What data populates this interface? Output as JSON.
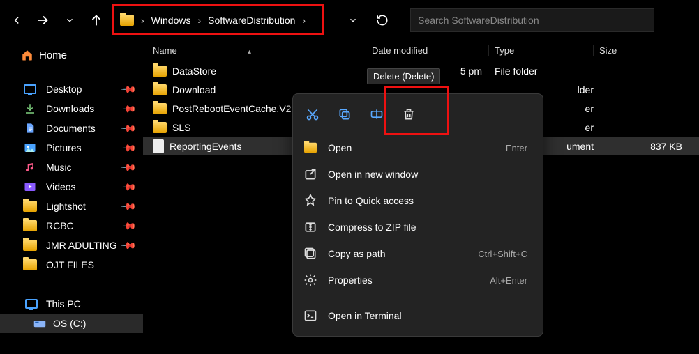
{
  "toolbar": {
    "breadcrumb": [
      "Windows",
      "SoftwareDistribution"
    ],
    "search_placeholder": "Search SoftwareDistribution"
  },
  "sidebar": {
    "home": "Home",
    "items": [
      {
        "label": "Desktop",
        "pin": true,
        "icon": "monitor"
      },
      {
        "label": "Downloads",
        "pin": true,
        "icon": "download"
      },
      {
        "label": "Documents",
        "pin": true,
        "icon": "document"
      },
      {
        "label": "Pictures",
        "pin": true,
        "icon": "pictures"
      },
      {
        "label": "Music",
        "pin": true,
        "icon": "music"
      },
      {
        "label": "Videos",
        "pin": true,
        "icon": "video"
      },
      {
        "label": "Lightshot",
        "pin": true,
        "icon": "folder"
      },
      {
        "label": "RCBC",
        "pin": true,
        "icon": "folder"
      },
      {
        "label": "JMR ADULTING",
        "pin": true,
        "icon": "folder"
      },
      {
        "label": "OJT FILES",
        "pin": false,
        "icon": "folder"
      }
    ],
    "thispc": "This PC",
    "drive": "OS (C:)"
  },
  "columns": {
    "name": "Name",
    "date": "Date modified",
    "type": "Type",
    "size": "Size"
  },
  "files": [
    {
      "name": "DataStore",
      "date": "5 pm",
      "type": "File folder",
      "size": "",
      "icon": "folder",
      "date_partial": true
    },
    {
      "name": "Download",
      "date": "",
      "type": "lder",
      "size": "",
      "icon": "folder"
    },
    {
      "name": "PostRebootEventCache.V2",
      "date": "",
      "type": "er",
      "size": "",
      "icon": "folder"
    },
    {
      "name": "SLS",
      "date": "",
      "type": "er",
      "size": "",
      "icon": "folder"
    },
    {
      "name": "ReportingEvents",
      "date": "",
      "type": "ument",
      "size": "837 KB",
      "icon": "file",
      "sel": true
    }
  ],
  "context_tooltip": "Delete (Delete)",
  "context_menu": {
    "top_icons": [
      "cut",
      "copy",
      "rename",
      "share",
      "delete"
    ],
    "items": [
      {
        "label": "Open",
        "shortcut": "Enter",
        "icon": "open"
      },
      {
        "label": "Open in new window",
        "shortcut": "",
        "icon": "new-window"
      },
      {
        "label": "Pin to Quick access",
        "shortcut": "",
        "icon": "pin"
      },
      {
        "label": "Compress to ZIP file",
        "shortcut": "",
        "icon": "zip"
      },
      {
        "label": "Copy as path",
        "shortcut": "Ctrl+Shift+C",
        "icon": "copy-path"
      },
      {
        "label": "Properties",
        "shortcut": "Alt+Enter",
        "icon": "properties"
      },
      {
        "sep": true
      },
      {
        "label": "Open in Terminal",
        "shortcut": "",
        "icon": "terminal"
      }
    ]
  }
}
